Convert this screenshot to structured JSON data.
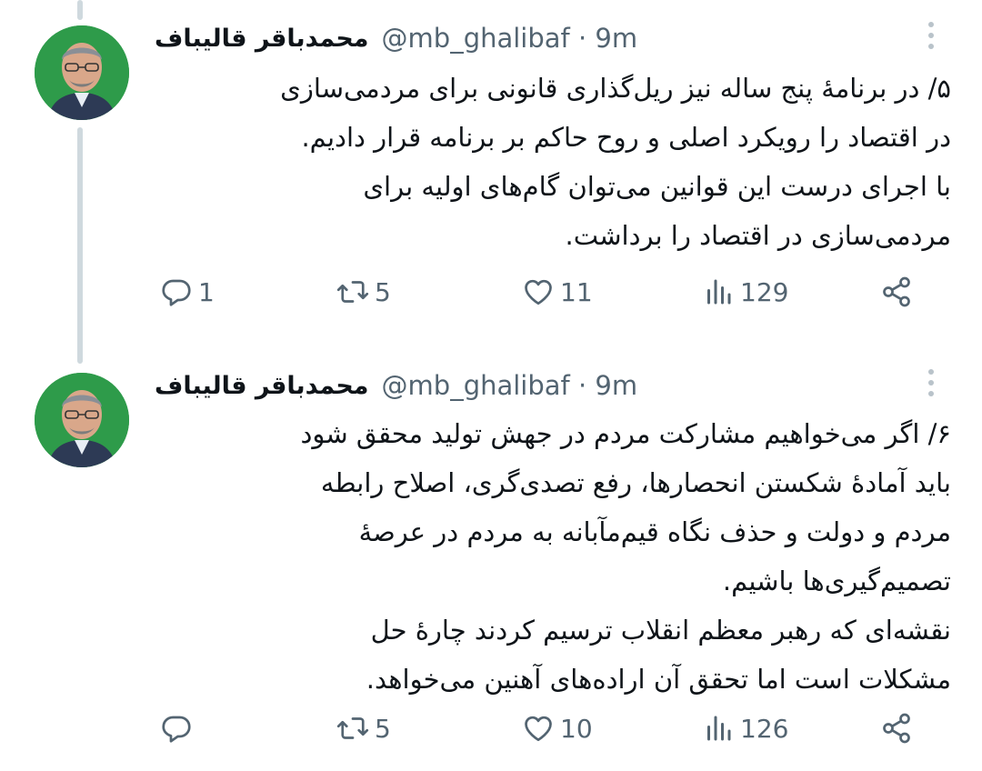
{
  "tweets": [
    {
      "author": {
        "display_name": "محمدباقر قالیباف",
        "handle_time": "@mb_ghalibaf · 9m"
      },
      "lines": [
        "۵/ در برنامهٔ پنج ساله نیز ریل‌گذاری قانونی برای مردمی‌سازی",
        "در اقتصاد را رویکرد اصلی و روح حاکم بر برنامه قرار دادیم.",
        "با اجرای درست این قوانین می‌توان گام‌های اولیه برای",
        "مردمی‌سازی در اقتصاد را برداشت."
      ],
      "stats": {
        "replies": "1",
        "retweets": "5",
        "likes": "11",
        "views": "129"
      }
    },
    {
      "author": {
        "display_name": "محمدباقر قالیباف",
        "handle_time": "@mb_ghalibaf · 9m"
      },
      "lines": [
        "۶/ اگر می‌خواهیم مشارکت مردم در جهش تولید محقق شود",
        "باید آمادهٔ شکستن انحصارها، رفع تصدی‌گری، اصلاح رابطه",
        "مردم و دولت و حذف نگاه قیم‌مآبانه به مردم در عرصهٔ",
        "تصمیم‌گیری‌ها باشیم.",
        "نقشه‌ای که رهبر معظم انقلاب ترسیم کردند چارهٔ حل",
        "مشکلات است اما تحقق آن اراده‌های آهنین می‌خواهد."
      ],
      "stats": {
        "replies": "",
        "retweets": "5",
        "likes": "10",
        "views": "126"
      }
    }
  ],
  "icons": {
    "reply": "reply-icon",
    "retweet": "retweet-icon",
    "like": "heart-icon",
    "views": "views-icon",
    "share": "share-icon",
    "more": "more-vertical-icon"
  },
  "colors": {
    "text": "#0f1419",
    "secondary": "#536471",
    "thread_line": "#cfd9de",
    "avatar_bg": "#2e9b4a"
  }
}
